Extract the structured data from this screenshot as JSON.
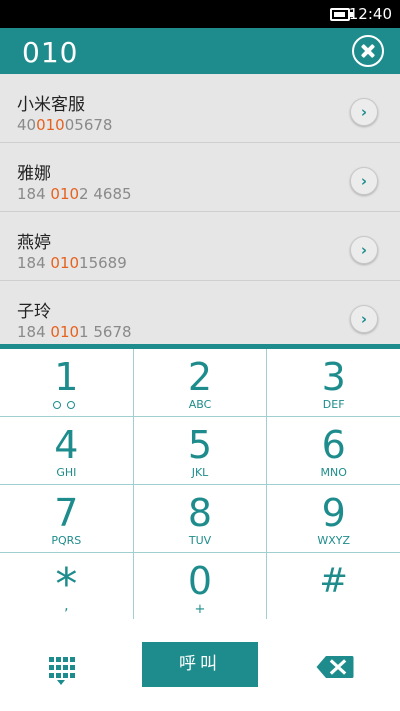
{
  "status_bar": {
    "time": "12:40"
  },
  "dial": {
    "number": "010"
  },
  "results": [
    {
      "name": "小米客服",
      "phone_pre": "40",
      "phone_hl": "010",
      "phone_post": "05678"
    },
    {
      "name": "雅娜",
      "phone_pre": "184 ",
      "phone_hl": "010",
      "phone_post": "2 4685"
    },
    {
      "name": "燕婷",
      "phone_pre": "184 ",
      "phone_hl": "010",
      "phone_post": "15689"
    },
    {
      "name": "子玲",
      "phone_pre": "184 ",
      "phone_hl": "010",
      "phone_post": "1 5678"
    }
  ],
  "keypad": {
    "k1": {
      "digit": "1",
      "letters": ""
    },
    "k2": {
      "digit": "2",
      "letters": "ABC"
    },
    "k3": {
      "digit": "3",
      "letters": "DEF"
    },
    "k4": {
      "digit": "4",
      "letters": "GHI"
    },
    "k5": {
      "digit": "5",
      "letters": "JKL"
    },
    "k6": {
      "digit": "6",
      "letters": "MNO"
    },
    "k7": {
      "digit": "7",
      "letters": "PQRS"
    },
    "k8": {
      "digit": "8",
      "letters": "TUV"
    },
    "k9": {
      "digit": "9",
      "letters": "WXYZ"
    },
    "kstar": {
      "digit": "*",
      "letters": ","
    },
    "k0": {
      "digit": "0",
      "letters": "+"
    },
    "khash": {
      "digit": "#",
      "letters": ""
    }
  },
  "call_button": {
    "label": "呼叫"
  },
  "icons": {
    "clear": "close-circle-icon",
    "result_arrow": "chevron-right-icon",
    "keypad_toggle": "grid-icon",
    "backspace": "backspace-icon",
    "battery": "battery-icon"
  },
  "colors": {
    "accent": "#1e8c8c",
    "highlight": "#e6621f",
    "result_bg": "#e6e6e6"
  }
}
